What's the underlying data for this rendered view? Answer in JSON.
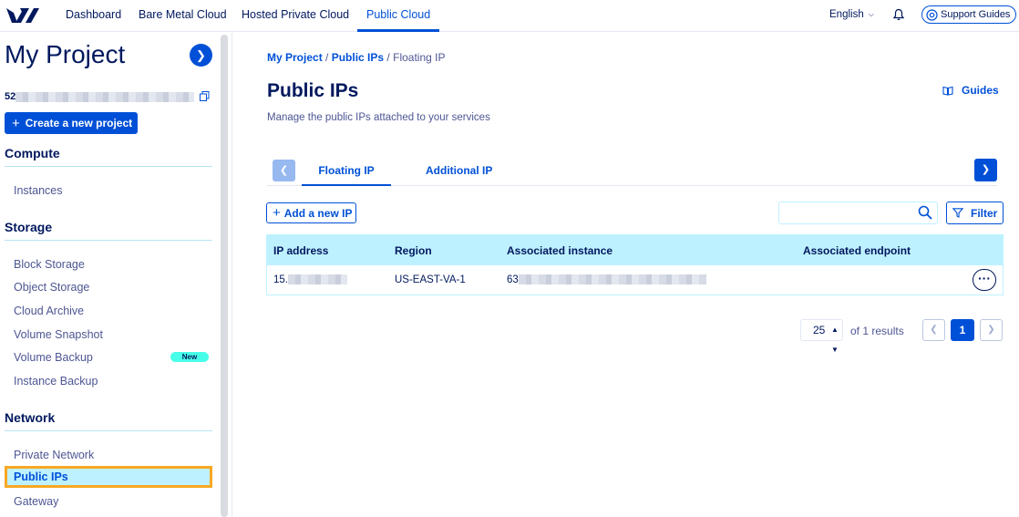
{
  "topnav": {
    "items": [
      {
        "label": "Dashboard"
      },
      {
        "label": "Bare Metal Cloud"
      },
      {
        "label": "Hosted Private Cloud"
      },
      {
        "label": "Public Cloud"
      }
    ],
    "active_index": 3,
    "language": "English",
    "support_label": "Support Guides"
  },
  "sidebar": {
    "project_title": "My Project",
    "project_id_prefix": "52",
    "create_label": "Create a new project",
    "sections": [
      {
        "title": "Compute",
        "items": [
          "Instances"
        ]
      },
      {
        "title": "Storage",
        "items": [
          "Block Storage",
          "Object Storage",
          "Cloud Archive",
          "Volume Snapshot",
          "Volume Backup",
          "Instance Backup"
        ]
      },
      {
        "title": "Network",
        "items": [
          "Private Network",
          "Public IPs",
          "Gateway"
        ]
      }
    ],
    "new_badge": "New",
    "selected_item": "Public IPs"
  },
  "main": {
    "breadcrumb": [
      "My Project",
      "Public IPs",
      "Floating IP"
    ],
    "title": "Public IPs",
    "guides_label": "Guides",
    "subtitle": "Manage the public IPs attached to your services",
    "tabs": [
      "Floating IP",
      "Additional IP"
    ],
    "active_tab": 0,
    "add_ip_label": "Add a new IP",
    "search_placeholder": "",
    "filter_label": "Filter",
    "table": {
      "columns": [
        "IP address",
        "Region",
        "Associated instance",
        "Associated endpoint"
      ],
      "rows": [
        {
          "ip_prefix": "15.",
          "region": "US-EAST-VA-1",
          "instance_prefix": "63",
          "endpoint": ""
        }
      ]
    },
    "pagination": {
      "page_size": "25",
      "results_text": "of 1 results",
      "current_page": "1"
    }
  },
  "colors": {
    "primary": "#0050d7",
    "navy": "#00185e",
    "highlight": "#bef1ff",
    "selection_outline": "#f7a823",
    "new_badge": "#47ffe8"
  }
}
